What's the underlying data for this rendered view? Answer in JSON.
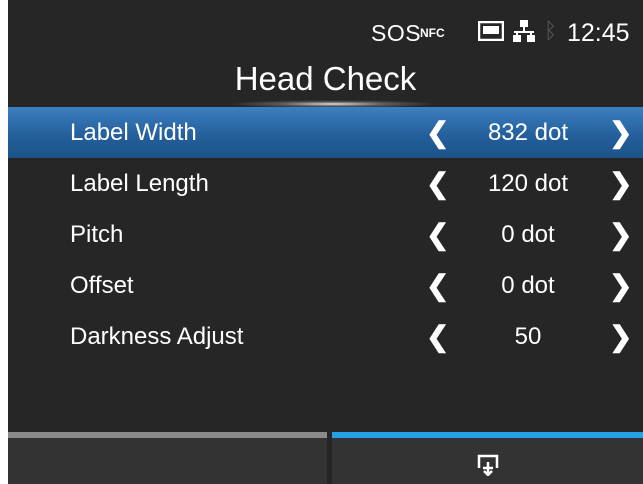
{
  "status": {
    "sos": "SOS",
    "nfc": "NFC",
    "time": "12:45",
    "icons": [
      "nfc-icon",
      "sd-card-icon",
      "network-icon",
      "bluetooth-icon"
    ]
  },
  "title": "Head Check",
  "items": [
    {
      "label": "Label Width",
      "value": "832 dot",
      "selected": true
    },
    {
      "label": "Label Length",
      "value": "120 dot",
      "selected": false
    },
    {
      "label": "Pitch",
      "value": "0 dot",
      "selected": false
    },
    {
      "label": "Offset",
      "value": "0 dot",
      "selected": false
    },
    {
      "label": "Darkness Adjust",
      "value": "50",
      "selected": false
    }
  ],
  "arrows": {
    "left": "❮",
    "right": "❯"
  },
  "colors": {
    "background": "#262626",
    "selected": "#2a6aa8",
    "softkey_left_bar": "#8a8a8a",
    "softkey_right_bar": "#27a1e6"
  },
  "softkeys": {
    "left_icon": "",
    "right_icon": "print-preview-icon"
  }
}
